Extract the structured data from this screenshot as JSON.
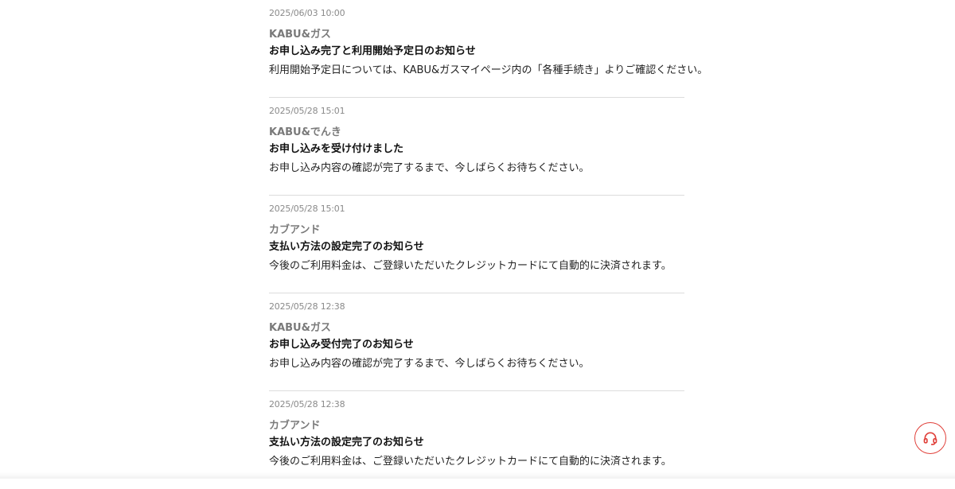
{
  "notices": [
    {
      "date": "2025/06/03 10:00",
      "sender": "KABU&ガス",
      "title": "お申し込み完了と利用開始予定日のお知らせ",
      "body": "利用開始予定日については、KABU&ガスマイページ内の「各種手続き」よりご確認ください。"
    },
    {
      "date": "2025/05/28 15:01",
      "sender": "KABU&でんき",
      "title": "お申し込みを受け付けました",
      "body": "お申し込み内容の確認が完了するまで、今しばらくお待ちください。"
    },
    {
      "date": "2025/05/28 15:01",
      "sender": "カブアンド",
      "title": "支払い方法の設定完了のお知らせ",
      "body": "今後のご利用料金は、ご登録いただいたクレジットカードにて自動的に決済されます。"
    },
    {
      "date": "2025/05/28 12:38",
      "sender": "KABU&ガス",
      "title": "お申し込み受付完了のお知らせ",
      "body": "お申し込み内容の確認が完了するまで、今しばらくお待ちください。"
    },
    {
      "date": "2025/05/28 12:38",
      "sender": "カブアンド",
      "title": "支払い方法の設定完了のお知らせ",
      "body": "今後のご利用料金は、ご登録いただいたクレジットカードにて自動的に決済されます。"
    }
  ],
  "support": {
    "icon": "headset-icon",
    "accent_color": "#e0403a"
  }
}
